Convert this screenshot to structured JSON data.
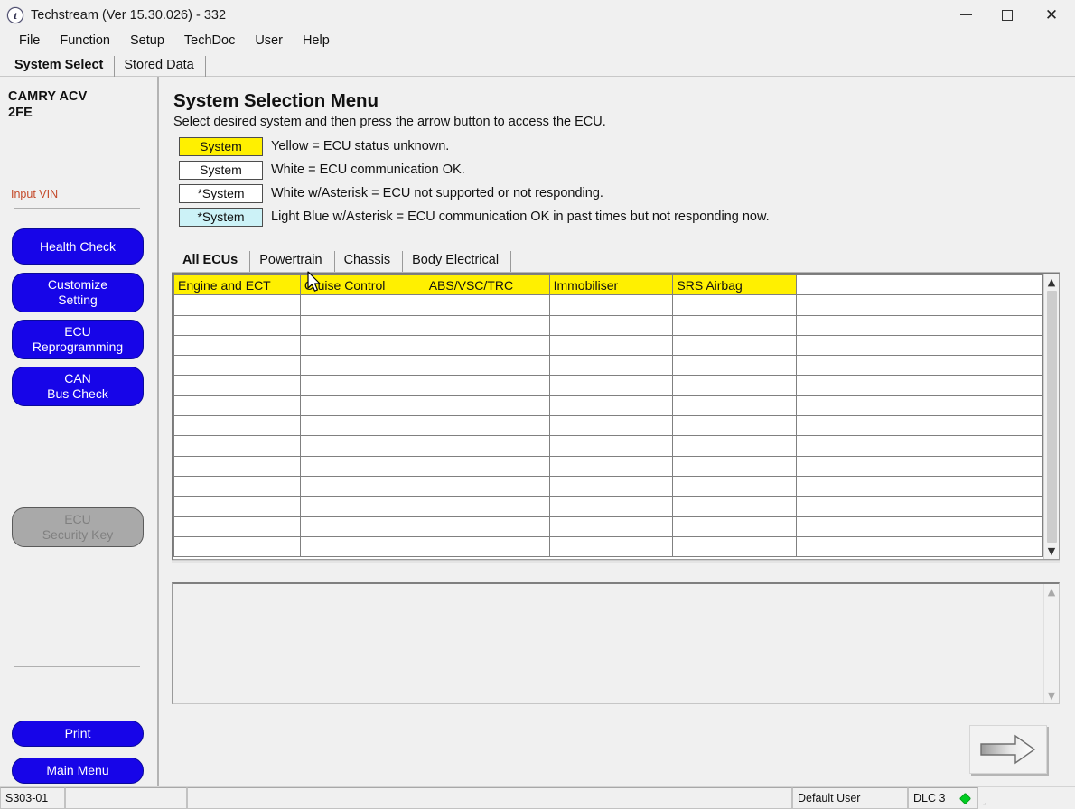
{
  "window": {
    "title": "Techstream (Ver 15.30.026) - 332",
    "icon": "techstream-logo-icon",
    "minimize_label": "—",
    "maximize_label": "☐",
    "close_label": "✕"
  },
  "menubar": {
    "items": [
      {
        "label": "File"
      },
      {
        "label": "Function"
      },
      {
        "label": "Setup"
      },
      {
        "label": "TechDoc"
      },
      {
        "label": "User"
      },
      {
        "label": "Help"
      }
    ]
  },
  "main_tabs": [
    {
      "label": "System Select",
      "active": true
    },
    {
      "label": "Stored Data",
      "active": false
    }
  ],
  "sidebar": {
    "vehicle_line1": "CAMRY ACV",
    "vehicle_line2": "2FE",
    "vin_link": "Input VIN",
    "buttons": [
      {
        "label": "Health Check",
        "enabled": true
      },
      {
        "label": "Customize\nSetting",
        "enabled": true
      },
      {
        "label": "ECU\nReprogramming",
        "enabled": true
      },
      {
        "label": "CAN\nBus Check",
        "enabled": true
      },
      {
        "label": "ECU\nSecurity Key",
        "enabled": false
      }
    ],
    "footer_buttons": [
      {
        "label": "Print",
        "enabled": true
      },
      {
        "label": "Main Menu",
        "enabled": true
      }
    ]
  },
  "main": {
    "title": "System Selection Menu",
    "subtitle": "Select desired system and then press the arrow button to access the ECU.",
    "legend": [
      {
        "chip": "System",
        "style": "yellow",
        "text": "Yellow = ECU status unknown."
      },
      {
        "chip": "System",
        "style": "white",
        "text": "White = ECU communication OK."
      },
      {
        "chip": "*System",
        "style": "white",
        "text": "White w/Asterisk = ECU not supported or not responding."
      },
      {
        "chip": "*System",
        "style": "blue",
        "text": "Light Blue w/Asterisk = ECU communication OK in past times but not responding now."
      }
    ],
    "ecu_tabs": [
      {
        "label": "All ECUs",
        "active": true
      },
      {
        "label": "Powertrain",
        "active": false
      },
      {
        "label": "Chassis",
        "active": false
      },
      {
        "label": "Body Electrical",
        "active": false
      }
    ],
    "grid": {
      "columns": 7,
      "rows": 14,
      "systems": [
        "Engine and ECT",
        "Cruise Control",
        "ABS/VSC/TRC",
        "Immobiliser",
        "SRS Airbag",
        "",
        ""
      ]
    },
    "info_panel_text": "",
    "next_button": "next-arrow-button"
  },
  "statusbar": {
    "code": "S303-01",
    "pane1": "",
    "pane2": "",
    "user": "Default User",
    "dlc": "DLC 3",
    "led_color": "#00cc22"
  },
  "colors": {
    "accent_blue": "#1705e8",
    "status_yellow": "#fff000",
    "status_lightblue": "#ccf2f7",
    "link_red": "#c44a2a",
    "disabled_gray": "#a9a9a9"
  }
}
